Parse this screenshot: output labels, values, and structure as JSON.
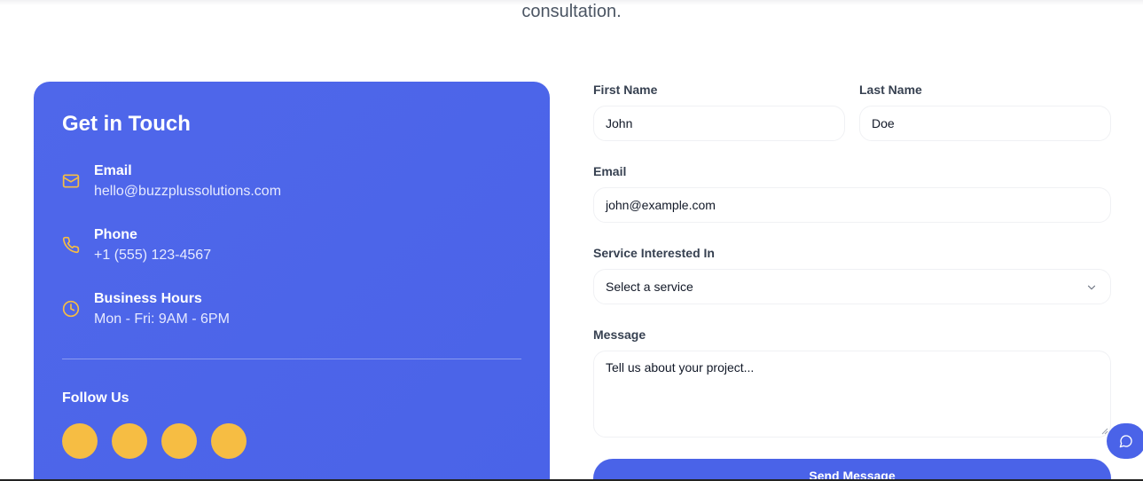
{
  "header": {
    "subtitle": "consultation."
  },
  "contact_card": {
    "title": "Get in Touch",
    "items": [
      {
        "icon": "mail-icon",
        "label": "Email",
        "value": "hello@buzzplussolutions.com"
      },
      {
        "icon": "phone-icon",
        "label": "Phone",
        "value": "+1 (555) 123-4567"
      },
      {
        "icon": "clock-icon",
        "label": "Business Hours",
        "value": "Mon - Fri: 9AM - 6PM"
      }
    ],
    "follow_label": "Follow Us",
    "socials": [
      "social-1",
      "social-2",
      "social-3",
      "social-4"
    ]
  },
  "form": {
    "first_name": {
      "label": "First Name",
      "placeholder": "John"
    },
    "last_name": {
      "label": "Last Name",
      "placeholder": "Doe"
    },
    "email": {
      "label": "Email",
      "placeholder": "john@example.com"
    },
    "service": {
      "label": "Service Interested In",
      "selected": "Select a service"
    },
    "message": {
      "label": "Message",
      "placeholder": "Tell us about your project..."
    },
    "submit_label": "Send Message"
  },
  "colors": {
    "accent": "#4a63e8",
    "icon_gold": "#f6bd43",
    "social": "#f6bd43"
  }
}
